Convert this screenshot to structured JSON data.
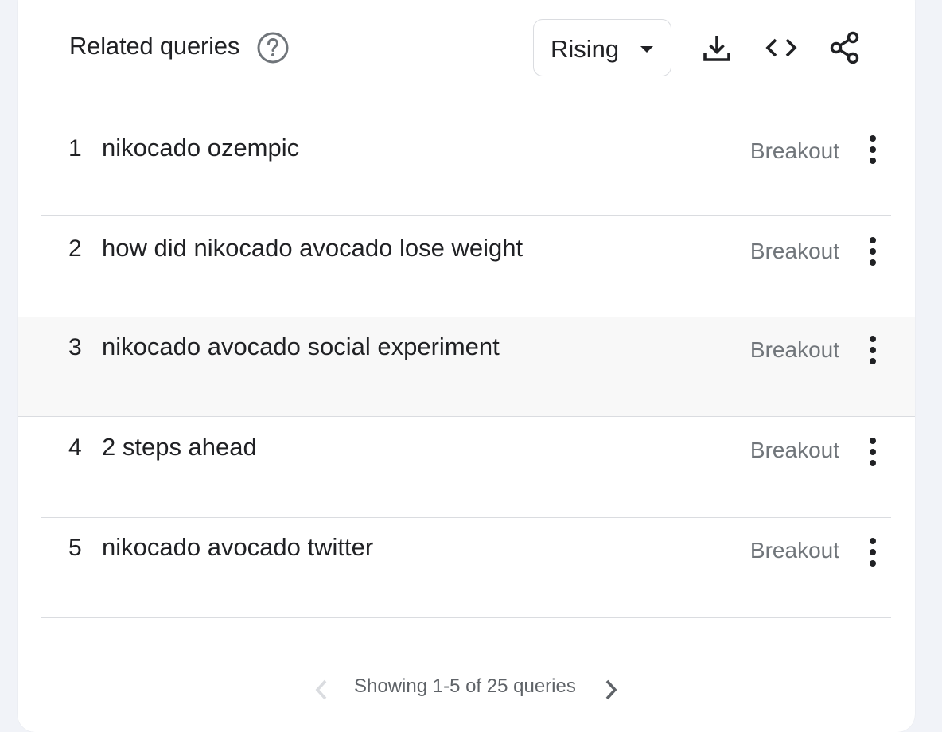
{
  "header": {
    "title": "Related queries",
    "help_icon": "help-circle-icon",
    "dropdown": {
      "selected": "Rising",
      "icon": "caret-down-icon"
    },
    "actions": [
      {
        "name": "download",
        "icon": "download-icon"
      },
      {
        "name": "embed",
        "icon": "code-icon"
      },
      {
        "name": "share",
        "icon": "share-icon"
      }
    ]
  },
  "rows": [
    {
      "rank": "1",
      "query": "nikocado ozempic",
      "value": "Breakout"
    },
    {
      "rank": "2",
      "query": "how did nikocado avocado lose weight",
      "value": "Breakout"
    },
    {
      "rank": "3",
      "query": "nikocado avocado social experiment",
      "value": "Breakout"
    },
    {
      "rank": "4",
      "query": "2 steps ahead",
      "value": "Breakout"
    },
    {
      "rank": "5",
      "query": "nikocado avocado twitter",
      "value": "Breakout"
    }
  ],
  "pagination": {
    "text": "Showing 1-5 of 25 queries",
    "prev_icon": "chevron-left-icon",
    "next_icon": "chevron-right-icon"
  },
  "colors": {
    "text_primary": "#202124",
    "text_secondary": "#70757a",
    "icon": "#5f6368",
    "divider": "#dadce0",
    "background": "#f1f3f8"
  }
}
